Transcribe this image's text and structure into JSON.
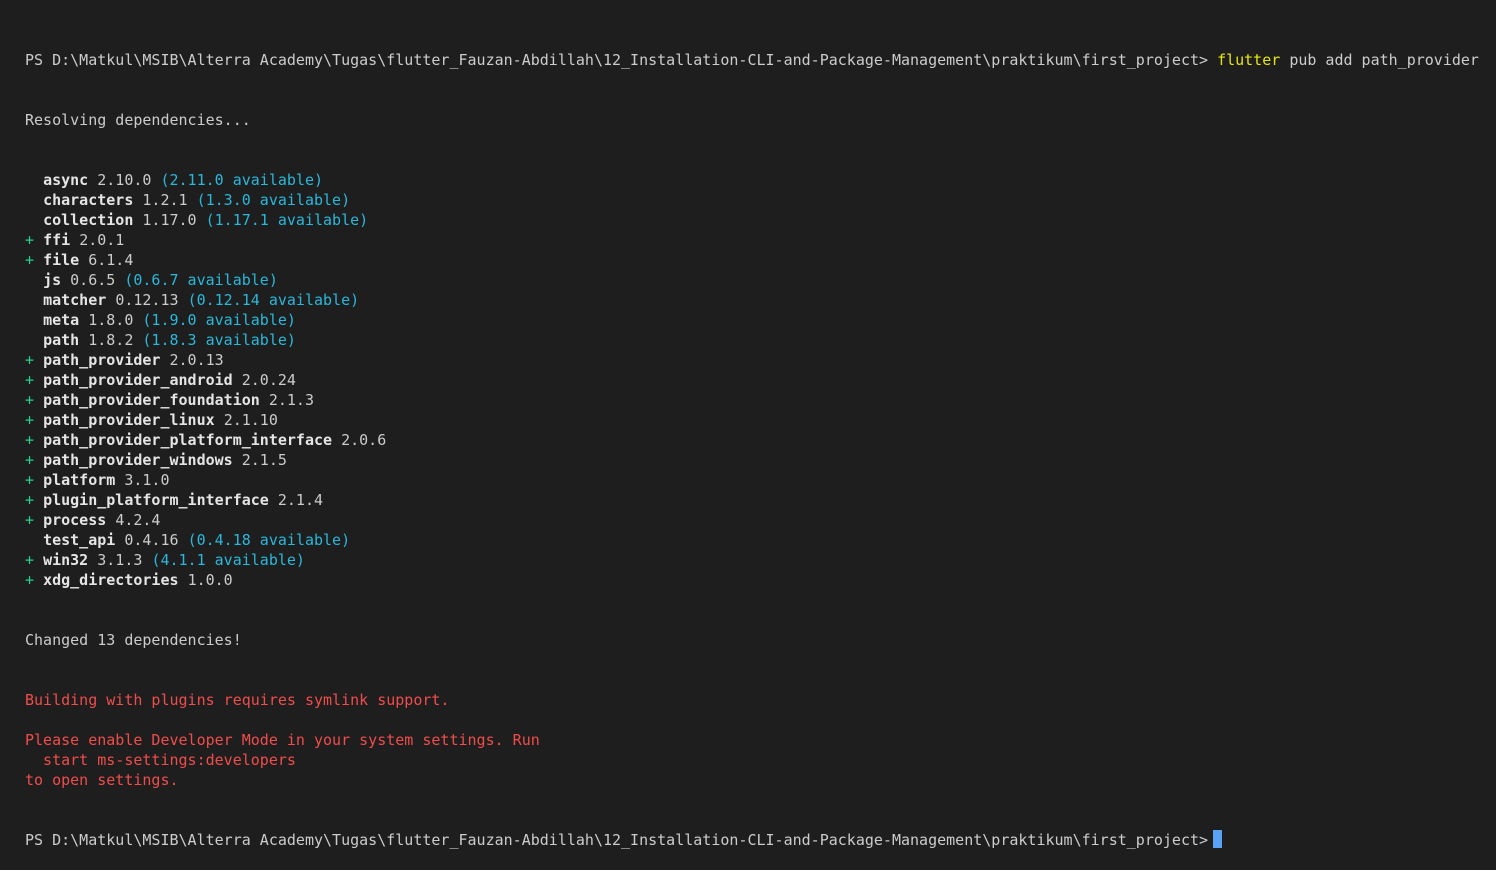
{
  "terminal": {
    "prompt": "PS D:\\Matkul\\MSIB\\Alterra Academy\\Tugas\\flutter_Fauzan-Abdillah\\12_Installation-CLI-and-Package-Management\\praktikum\\first_project>",
    "command_name": "flutter",
    "command_args": "pub add path_provider",
    "resolving": "Resolving dependencies...",
    "packages": [
      {
        "marker": " ",
        "name": "async",
        "version": "2.10.0",
        "available": "(2.11.0 available)"
      },
      {
        "marker": " ",
        "name": "characters",
        "version": "1.2.1",
        "available": "(1.3.0 available)"
      },
      {
        "marker": " ",
        "name": "collection",
        "version": "1.17.0",
        "available": "(1.17.1 available)"
      },
      {
        "marker": "+",
        "name": "ffi",
        "version": "2.0.1",
        "available": ""
      },
      {
        "marker": "+",
        "name": "file",
        "version": "6.1.4",
        "available": ""
      },
      {
        "marker": " ",
        "name": "js",
        "version": "0.6.5",
        "available": "(0.6.7 available)"
      },
      {
        "marker": " ",
        "name": "matcher",
        "version": "0.12.13",
        "available": "(0.12.14 available)"
      },
      {
        "marker": " ",
        "name": "meta",
        "version": "1.8.0",
        "available": "(1.9.0 available)"
      },
      {
        "marker": " ",
        "name": "path",
        "version": "1.8.2",
        "available": "(1.8.3 available)"
      },
      {
        "marker": "+",
        "name": "path_provider",
        "version": "2.0.13",
        "available": ""
      },
      {
        "marker": "+",
        "name": "path_provider_android",
        "version": "2.0.24",
        "available": ""
      },
      {
        "marker": "+",
        "name": "path_provider_foundation",
        "version": "2.1.3",
        "available": ""
      },
      {
        "marker": "+",
        "name": "path_provider_linux",
        "version": "2.1.10",
        "available": ""
      },
      {
        "marker": "+",
        "name": "path_provider_platform_interface",
        "version": "2.0.6",
        "available": ""
      },
      {
        "marker": "+",
        "name": "path_provider_windows",
        "version": "2.1.5",
        "available": ""
      },
      {
        "marker": "+",
        "name": "platform",
        "version": "3.1.0",
        "available": ""
      },
      {
        "marker": "+",
        "name": "plugin_platform_interface",
        "version": "2.1.4",
        "available": ""
      },
      {
        "marker": "+",
        "name": "process",
        "version": "4.2.4",
        "available": ""
      },
      {
        "marker": " ",
        "name": "test_api",
        "version": "0.4.16",
        "available": "(0.4.18 available)"
      },
      {
        "marker": "+",
        "name": "win32",
        "version": "3.1.3",
        "available": "(4.1.1 available)"
      },
      {
        "marker": "+",
        "name": "xdg_directories",
        "version": "1.0.0",
        "available": ""
      }
    ],
    "changed": "Changed 13 dependencies!",
    "error_lines": [
      "Building with plugins requires symlink support.",
      "",
      "Please enable Developer Mode in your system settings. Run",
      "  start ms-settings:developers",
      "to open settings."
    ]
  },
  "colors": {
    "background": "#1e1e1e",
    "text": "#cccccc",
    "added_marker": "#23d18b",
    "available": "#29b8db",
    "error": "#f14c4c",
    "command": "#e5e510",
    "cursor": "#5aa2f6"
  }
}
